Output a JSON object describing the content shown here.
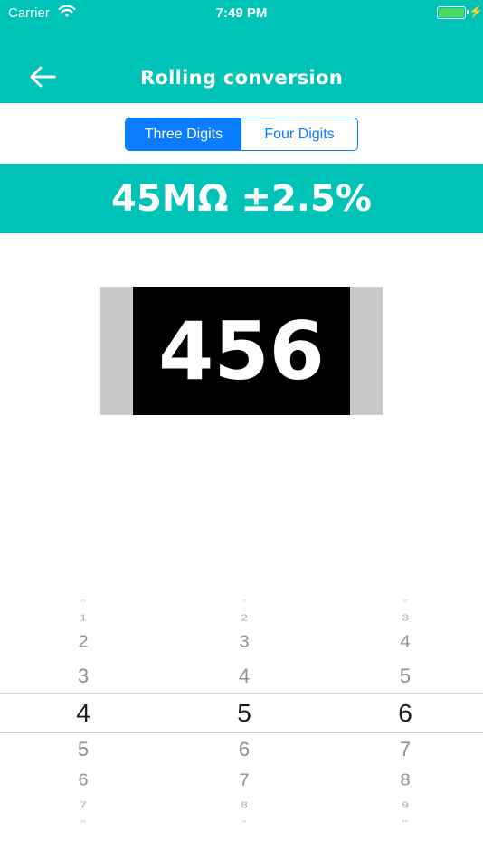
{
  "status_bar": {
    "carrier": "Carrier",
    "time": "7:49 PM",
    "battery_color": "#4cd964"
  },
  "nav": {
    "title": "Rolling conversion",
    "back_icon": "arrow-left-icon"
  },
  "segmented": {
    "options": [
      "Three Digits",
      "Four Digits"
    ],
    "selected": "Three Digits"
  },
  "result": {
    "value": "45MΩ ±2.5%"
  },
  "resistor": {
    "code": "456"
  },
  "picker": {
    "columns": [
      {
        "values": [
          "0",
          "1",
          "2",
          "3",
          "4",
          "5",
          "6",
          "7",
          "8"
        ],
        "selected": "4"
      },
      {
        "values": [
          "1",
          "2",
          "3",
          "4",
          "5",
          "6",
          "7",
          "8",
          "9"
        ],
        "selected": "5"
      },
      {
        "values": [
          "2",
          "3",
          "4",
          "5",
          "6",
          "7",
          "8",
          "9",
          "R"
        ],
        "selected": "6"
      }
    ]
  },
  "colors": {
    "accent": "#00c3b8",
    "segment_blue": "#0a7cff"
  }
}
